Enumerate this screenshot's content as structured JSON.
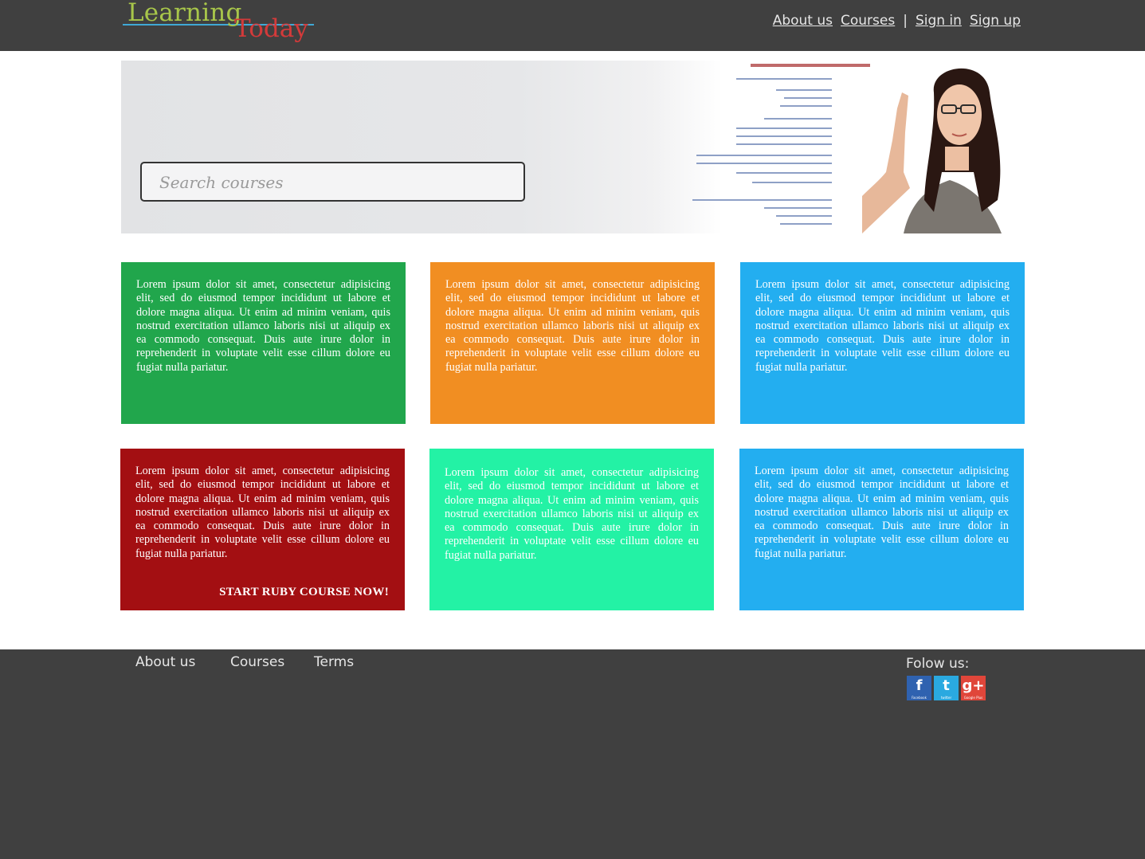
{
  "header": {
    "logo": {
      "word1": "Learning",
      "word2": "Today"
    },
    "nav": {
      "about": "About us",
      "courses": "Courses",
      "separator": "|",
      "signin": "Sign in",
      "signup": "Sign up"
    }
  },
  "hero": {
    "search": {
      "placeholder": "Search courses",
      "value": ""
    }
  },
  "cards": [
    {
      "text": "Lorem ipsum dolor sit amet, consectetur adipisicing elit, sed do eiusmod tempor incididunt ut labore et dolore magna aliqua. Ut enim ad minim veniam, quis nostrud exercitation ullamco laboris nisi ut aliquip ex ea commodo consequat. Duis aute irure dolor in reprehenderit in voluptate velit esse cillum dolore eu fugiat nulla pariatur.",
      "color": "#21a64c"
    },
    {
      "text": "Lorem ipsum dolor sit amet, consectetur adipisicing elit, sed do eiusmod tempor incididunt ut labore et dolore magna aliqua. Ut enim ad minim veniam, quis nostrud exercitation ullamco laboris nisi ut aliquip ex ea commodo consequat. Duis aute irure dolor in reprehenderit in voluptate velit esse cillum dolore eu fugiat nulla pariatur.",
      "color": "#f18e22"
    },
    {
      "text": "Lorem ipsum dolor sit amet, consectetur adipisicing elit, sed do eiusmod tempor incididunt ut labore et dolore magna aliqua. Ut enim ad minim veniam, quis nostrud exercitation ullamco laboris nisi ut aliquip ex ea commodo consequat. Duis aute irure dolor in reprehenderit in voluptate velit esse cillum dolore eu fugiat nulla pariatur.",
      "color": "#23aef0"
    },
    {
      "text": "Lorem ipsum dolor sit amet, consectetur adipisicing elit, sed do eiusmod tempor incididunt ut labore et dolore magna aliqua. Ut enim ad minim veniam, quis nostrud exercitation ullamco laboris nisi ut aliquip ex ea commodo consequat. Duis aute irure dolor in reprehenderit in voluptate velit esse cillum dolore eu fugiat nulla pariatur.",
      "color": "#a30f12",
      "cta": "START RUBY COURSE NOW!"
    },
    {
      "text": "Lorem ipsum dolor sit amet, consectetur adipisicing elit, sed do eiusmod tempor incididunt ut labore et dolore magna aliqua. Ut enim ad minim veniam, quis nostrud exercitation ullamco laboris nisi ut aliquip ex ea commodo consequat. Duis aute irure dolor in reprehenderit in voluptate velit esse cillum dolore eu fugiat nulla pariatur.",
      "color": "#23f2a5"
    },
    {
      "text": "Lorem ipsum dolor sit amet, consectetur adipisicing elit, sed do eiusmod tempor incididunt ut labore et dolore magna aliqua. Ut enim ad minim veniam, quis nostrud exercitation ullamco laboris nisi ut aliquip ex ea commodo consequat. Duis aute irure dolor in reprehenderit in voluptate velit esse cillum dolore eu fugiat nulla pariatur.",
      "color": "#23aef0"
    }
  ],
  "footer": {
    "links": {
      "about": "About us",
      "courses": "Courses",
      "terms": "Terms"
    },
    "follow_label": "Folow us:",
    "social": [
      {
        "icon": "facebook-icon",
        "glyph": "f",
        "caption": "Facebook",
        "color": "#2f62b0"
      },
      {
        "icon": "twitter-icon",
        "glyph": "t",
        "caption": "twitter",
        "color": "#2aa9e0"
      },
      {
        "icon": "google-plus-icon",
        "glyph": "g+",
        "caption": "Google Plus",
        "color": "#e0463a"
      }
    ]
  }
}
